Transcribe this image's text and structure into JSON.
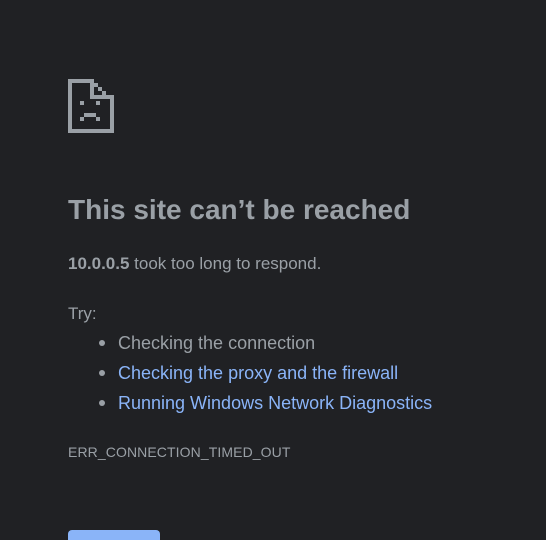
{
  "error": {
    "icon": "sad-page-icon",
    "title": "This site can’t be reached",
    "host": "10.0.0.5",
    "message_suffix": " took too long to respond.",
    "try_label": "Try:",
    "suggestions": [
      {
        "label": "Checking the connection",
        "is_link": false
      },
      {
        "label": "Checking the proxy and the firewall",
        "is_link": true
      },
      {
        "label": "Running Windows Network Diagnostics",
        "is_link": true
      }
    ],
    "code": "ERR_CONNECTION_TIMED_OUT"
  },
  "colors": {
    "background": "#202124",
    "text": "#9aa0a6",
    "link": "#8ab4f8",
    "button": "#8ab4f8"
  }
}
